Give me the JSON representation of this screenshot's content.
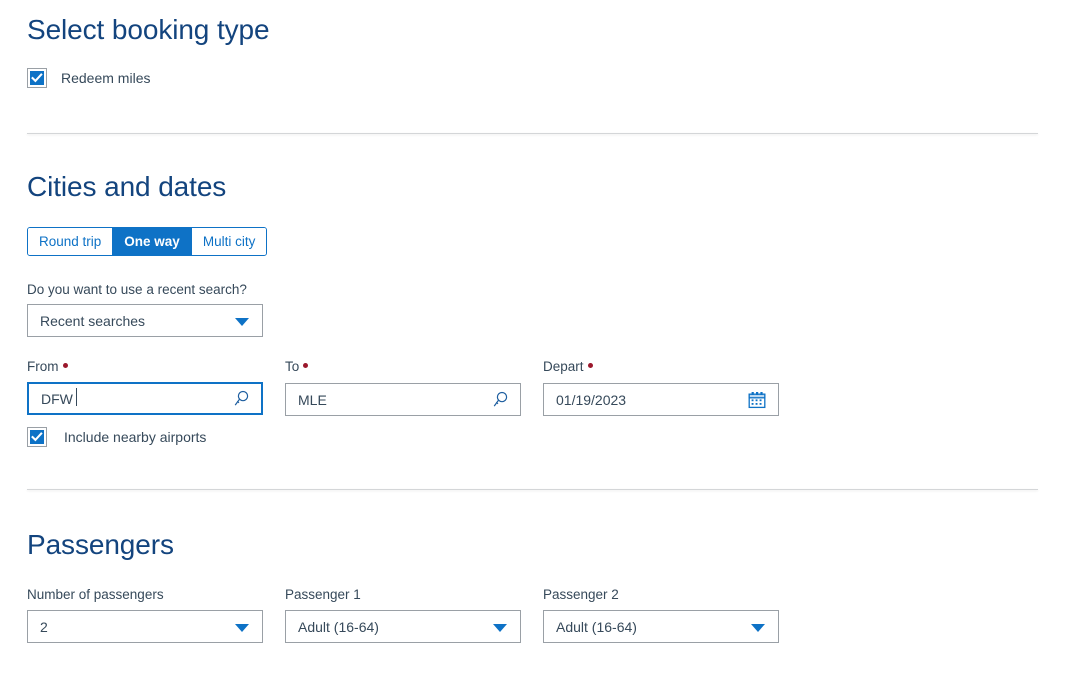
{
  "booking_type": {
    "heading": "Select booking type",
    "redeem_miles": {
      "label": "Redeem miles",
      "checked": true
    }
  },
  "cities_and_dates": {
    "heading": "Cities and dates",
    "trip_type": {
      "options": [
        {
          "label": "Round trip",
          "selected": false
        },
        {
          "label": "One way",
          "selected": true
        },
        {
          "label": "Multi city",
          "selected": false
        }
      ]
    },
    "recent_search": {
      "label": "Do you want to use a recent search?",
      "value": "Recent searches"
    },
    "from": {
      "label": "From",
      "required": true,
      "value": "DFW",
      "focused": true,
      "icon": "search-icon"
    },
    "to": {
      "label": "To",
      "required": true,
      "value": "MLE",
      "focused": false,
      "icon": "search-icon"
    },
    "depart": {
      "label": "Depart",
      "required": true,
      "value": "01/19/2023",
      "icon": "calendar-icon"
    },
    "nearby_airports": {
      "label": "Include nearby airports",
      "checked": true
    }
  },
  "passengers": {
    "heading": "Passengers",
    "number_of_passengers": {
      "label": "Number of passengers",
      "value": "2"
    },
    "passenger_1": {
      "label": "Passenger 1",
      "value": "Adult (16-64)"
    },
    "passenger_2": {
      "label": "Passenger 2",
      "value": "Adult (16-64)"
    }
  },
  "colors": {
    "heading_blue": "#13447e",
    "accent_blue": "#0e72c6",
    "required_red": "#9b182c",
    "text": "#36495a",
    "border_gray": "#9aa0a6",
    "divider_gray": "#d4d6d8"
  }
}
